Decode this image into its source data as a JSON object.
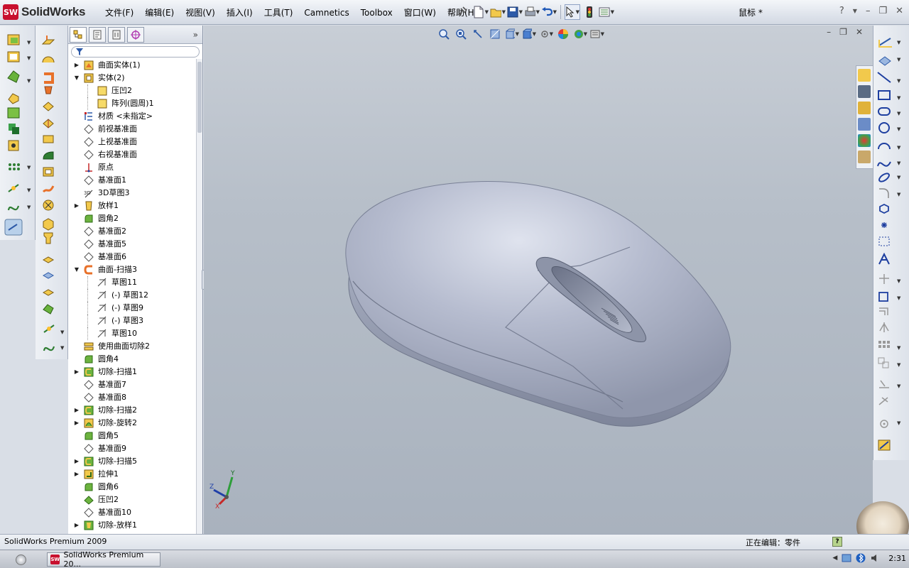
{
  "app": {
    "brand_ds": "SW",
    "brand_name": "SolidWorks",
    "document_title": "鼠标 *"
  },
  "menu": {
    "items": [
      "文件(F)",
      "编辑(E)",
      "视图(V)",
      "插入(I)",
      "工具(T)",
      "Camnetics",
      "Toolbox",
      "窗口(W)",
      "帮助(H)"
    ]
  },
  "window_controls": {
    "help": "?",
    "minimize": "–",
    "restore": "❐",
    "close": "✕"
  },
  "viewport_controls": {
    "minimize": "–",
    "restore": "❐",
    "close": "✕"
  },
  "feature_tree": {
    "collapse_glyph": "»",
    "items": [
      {
        "label": "曲面实体(1)",
        "indent": 0,
        "expander": "▶",
        "icon": "surface-bodies-icon"
      },
      {
        "label": "实体(2)",
        "indent": 0,
        "expander": "▼",
        "icon": "solid-bodies-icon"
      },
      {
        "label": "压凹2",
        "indent": 1,
        "expander": "",
        "icon": "body-icon"
      },
      {
        "label": "阵列(圆周)1",
        "indent": 1,
        "expander": "",
        "icon": "body-icon"
      },
      {
        "label": "材质 <未指定>",
        "indent": 0,
        "expander": "",
        "icon": "material-icon"
      },
      {
        "label": "前视基准面",
        "indent": 0,
        "expander": "",
        "icon": "plane-icon"
      },
      {
        "label": "上视基准面",
        "indent": 0,
        "expander": "",
        "icon": "plane-icon"
      },
      {
        "label": "右视基准面",
        "indent": 0,
        "expander": "",
        "icon": "plane-icon"
      },
      {
        "label": "原点",
        "indent": 0,
        "expander": "",
        "icon": "origin-icon"
      },
      {
        "label": "基准面1",
        "indent": 0,
        "expander": "",
        "icon": "plane-icon"
      },
      {
        "label": "3D草图3",
        "indent": 0,
        "expander": "",
        "icon": "3d-sketch-icon"
      },
      {
        "label": "放样1",
        "indent": 0,
        "expander": "▶",
        "icon": "loft-icon"
      },
      {
        "label": "圆角2",
        "indent": 0,
        "expander": "",
        "icon": "fillet-icon"
      },
      {
        "label": "基准面2",
        "indent": 0,
        "expander": "",
        "icon": "plane-icon"
      },
      {
        "label": "基准面5",
        "indent": 0,
        "expander": "",
        "icon": "plane-icon"
      },
      {
        "label": "基准面6",
        "indent": 0,
        "expander": "",
        "icon": "plane-icon"
      },
      {
        "label": "曲面-扫描3",
        "indent": 0,
        "expander": "▼",
        "icon": "surface-sweep-icon"
      },
      {
        "label": "草图11",
        "indent": 1,
        "expander": "",
        "icon": "sketch-icon"
      },
      {
        "label": "(-) 草图12",
        "indent": 1,
        "expander": "",
        "icon": "sketch-icon"
      },
      {
        "label": "(-) 草图9",
        "indent": 1,
        "expander": "",
        "icon": "sketch-icon"
      },
      {
        "label": "(-) 草图3",
        "indent": 1,
        "expander": "",
        "icon": "sketch-icon"
      },
      {
        "label": "草图10",
        "indent": 1,
        "expander": "",
        "icon": "sketch-icon"
      },
      {
        "label": "使用曲面切除2",
        "indent": 0,
        "expander": "",
        "icon": "surface-cut-icon"
      },
      {
        "label": "圆角4",
        "indent": 0,
        "expander": "",
        "icon": "fillet-icon"
      },
      {
        "label": "切除-扫描1",
        "indent": 0,
        "expander": "▶",
        "icon": "cut-sweep-icon"
      },
      {
        "label": "基准面7",
        "indent": 0,
        "expander": "",
        "icon": "plane-icon"
      },
      {
        "label": "基准面8",
        "indent": 0,
        "expander": "",
        "icon": "plane-icon"
      },
      {
        "label": "切除-扫描2",
        "indent": 0,
        "expander": "▶",
        "icon": "cut-sweep-icon"
      },
      {
        "label": "切除-旋转2",
        "indent": 0,
        "expander": "▶",
        "icon": "cut-revolve-icon"
      },
      {
        "label": "圆角5",
        "indent": 0,
        "expander": "",
        "icon": "fillet-icon"
      },
      {
        "label": "基准面9",
        "indent": 0,
        "expander": "",
        "icon": "plane-icon"
      },
      {
        "label": "切除-扫描5",
        "indent": 0,
        "expander": "▶",
        "icon": "cut-sweep-icon"
      },
      {
        "label": "拉伸1",
        "indent": 0,
        "expander": "▶",
        "icon": "extrude-icon"
      },
      {
        "label": "圆角6",
        "indent": 0,
        "expander": "",
        "icon": "fillet-icon"
      },
      {
        "label": "压凹2",
        "indent": 0,
        "expander": "",
        "icon": "indent-icon"
      },
      {
        "label": "基准面10",
        "indent": 0,
        "expander": "",
        "icon": "plane-icon"
      },
      {
        "label": "切除-放样1",
        "indent": 0,
        "expander": "▶",
        "icon": "cut-loft-icon"
      }
    ]
  },
  "triad": {
    "x": "X",
    "y": "Y",
    "z": "Z"
  },
  "status": {
    "left": "SolidWorks Premium 2009",
    "right": "正在编辑：零件",
    "help": "?"
  },
  "taskbar": {
    "item_icon": "SW",
    "item_label": "SolidWorks Premium 20...",
    "clock": "2:31"
  },
  "colors": {
    "brand_red": "#c8102e",
    "viewport_bg": "#b7bfc9",
    "model_surface": "#a9b0c4"
  }
}
